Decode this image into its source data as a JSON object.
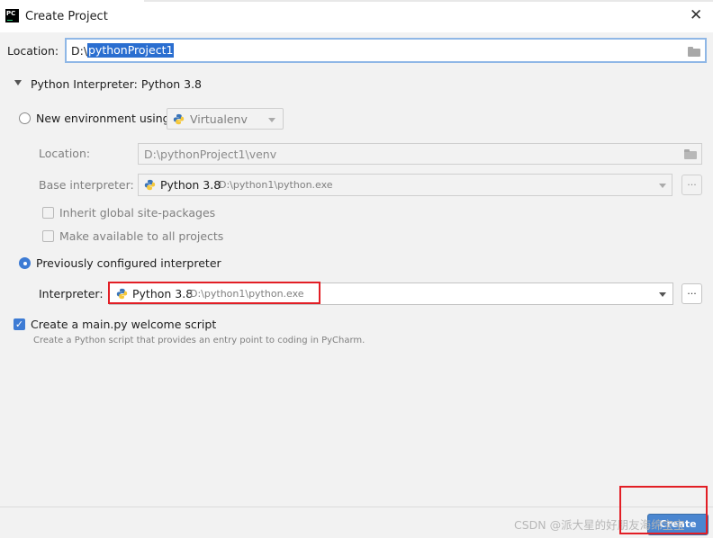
{
  "window": {
    "title": "Create Project",
    "logo_text": "PC"
  },
  "location": {
    "label": "Location:",
    "prefix": "D:\\",
    "selected": "pythonProject1"
  },
  "interpreter_section": {
    "title": "Python Interpreter: Python 3.8"
  },
  "new_env": {
    "radio_label": "New environment using",
    "tool": "Virtualenv",
    "location_label": "Location:",
    "location_value": "D:\\pythonProject1\\venv",
    "base_label": "Base interpreter:",
    "base_version": "Python 3.8",
    "base_path": "D:\\python1\\python.exe",
    "inherit_label": "Inherit global site-packages",
    "available_label": "Make available to all projects",
    "more": "..."
  },
  "prev_configured": {
    "radio_label": "Previously configured interpreter",
    "interpreter_label": "Interpreter:",
    "version": "Python 3.8",
    "path": "D:\\python1\\python.exe",
    "more": "..."
  },
  "welcome": {
    "checkbox_label": "Create a main.py welcome script",
    "description": "Create a Python script that provides an entry point to coding in PyCharm.",
    "checkmark": "✓"
  },
  "footer": {
    "create_label": "Create",
    "watermark": "CSDN @派大星的好朋友海绵宝宝"
  },
  "colors": {
    "accent": "#3d7bd4",
    "highlight": "#e21e25",
    "selection": "#2a6ed0"
  }
}
